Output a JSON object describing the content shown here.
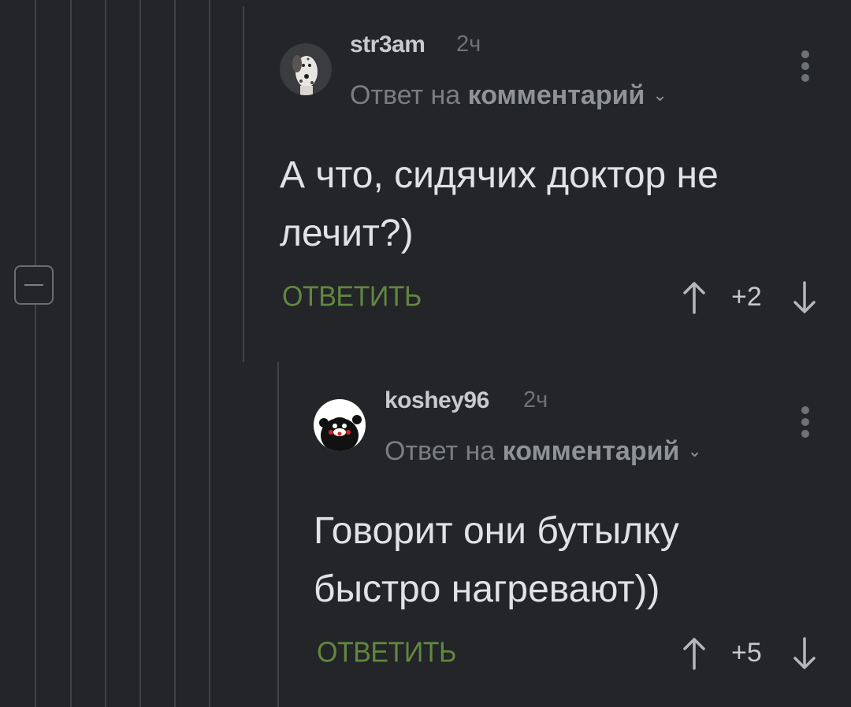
{
  "comments": [
    {
      "username": "str3am",
      "time": "2ч",
      "reply_prefix": "Ответ на",
      "reply_target": "комментарий",
      "text_lines": [
        "А что, сидячих доктор не",
        "лечит?)"
      ],
      "reply_label": "ОТВЕТИТЬ",
      "score": "+2",
      "avatar_icon": "dalmatian-dog-avatar"
    },
    {
      "username": "koshey96",
      "time": "2ч",
      "reply_prefix": "Ответ на",
      "reply_target": "комментарий",
      "text_lines": [
        "Говорит они бутылку",
        "быстро нагревают))"
      ],
      "reply_label": "ОТВЕТИТЬ",
      "score": "+5",
      "avatar_icon": "kumamon-bear-avatar"
    }
  ],
  "icons": {
    "collapse": "minus-square-icon",
    "more": "vertical-dots-icon",
    "upvote": "arrow-up-icon",
    "downvote": "arrow-down-icon",
    "expand": "chevron-down-icon"
  },
  "colors": {
    "background": "#232529",
    "reply_button": "#62873f",
    "thread_line": "#3f4247"
  }
}
